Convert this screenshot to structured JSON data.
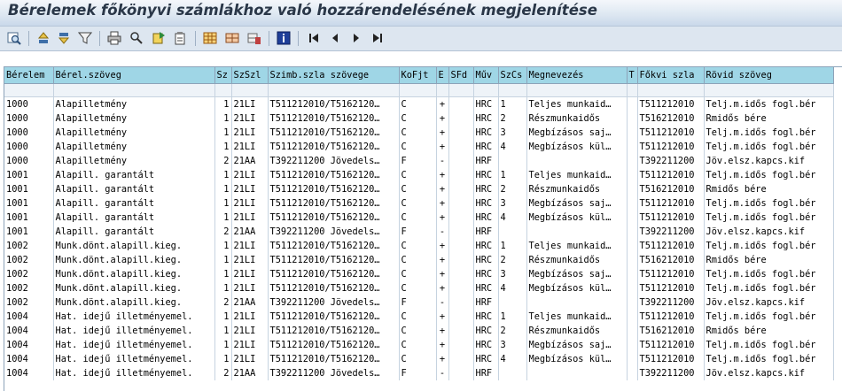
{
  "window": {
    "title": "Bérelemek főkönyvi számlákhoz való hozzárendelésének megjelenítése"
  },
  "toolbar": [
    {
      "name": "detail-icon",
      "interactable": true
    },
    {
      "name": "sort-ascending-icon",
      "interactable": true
    },
    {
      "name": "sort-descending-icon",
      "interactable": true
    },
    {
      "name": "filter-icon",
      "interactable": true
    },
    {
      "name": "print-icon",
      "interactable": true
    },
    {
      "name": "find-icon",
      "interactable": true
    },
    {
      "name": "find-next-icon",
      "interactable": true
    },
    {
      "name": "export-icon",
      "interactable": true
    },
    {
      "name": "layout-grid-icon",
      "interactable": true
    },
    {
      "name": "change-layout-icon",
      "interactable": true
    },
    {
      "name": "save-layout-icon",
      "interactable": true
    },
    {
      "name": "info-icon",
      "interactable": true
    },
    {
      "name": "first-page-icon",
      "interactable": true
    },
    {
      "name": "previous-page-icon",
      "interactable": true
    },
    {
      "name": "next-page-icon",
      "interactable": true
    },
    {
      "name": "last-page-icon",
      "interactable": true
    }
  ],
  "table": {
    "columns": [
      "Bérelem",
      "Bérel.szöveg",
      "Sz",
      "SzSzl",
      "Szimb.szla szövege",
      "KoFjt",
      "E",
      "SFd",
      "Műv",
      "SzCs",
      "Megnevezés",
      "T",
      "Főkvi szla",
      "Rövid szöveg"
    ],
    "rows": [
      [
        "1000",
        "Alapilletmény",
        "1",
        "21LI",
        "T511212010/T5162120…",
        "C",
        "+",
        "",
        "HRC",
        "1",
        "Teljes munkaid…",
        "",
        "T511212010",
        "Telj.m.idős fogl.bér"
      ],
      [
        "1000",
        "Alapilletmény",
        "1",
        "21LI",
        "T511212010/T5162120…",
        "C",
        "+",
        "",
        "HRC",
        "2",
        "Részmunkaidős",
        "",
        "T516212010",
        "Rmidős bére"
      ],
      [
        "1000",
        "Alapilletmény",
        "1",
        "21LI",
        "T511212010/T5162120…",
        "C",
        "+",
        "",
        "HRC",
        "3",
        "Megbízásos saj…",
        "",
        "T511212010",
        "Telj.m.idős fogl.bér"
      ],
      [
        "1000",
        "Alapilletmény",
        "1",
        "21LI",
        "T511212010/T5162120…",
        "C",
        "+",
        "",
        "HRC",
        "4",
        "Megbízásos kül…",
        "",
        "T511212010",
        "Telj.m.idős fogl.bér"
      ],
      [
        "1000",
        "Alapilletmény",
        "2",
        "21AA",
        "T392211200 Jövedels…",
        "F",
        "-",
        "",
        "HRF",
        "",
        "",
        "",
        "T392211200",
        "Jöv.elsz.kapcs.kif"
      ],
      [
        "1001",
        "Alapill. garantált",
        "1",
        "21LI",
        "T511212010/T5162120…",
        "C",
        "+",
        "",
        "HRC",
        "1",
        "Teljes munkaid…",
        "",
        "T511212010",
        "Telj.m.idős fogl.bér"
      ],
      [
        "1001",
        "Alapill. garantált",
        "1",
        "21LI",
        "T511212010/T5162120…",
        "C",
        "+",
        "",
        "HRC",
        "2",
        "Részmunkaidős",
        "",
        "T516212010",
        "Rmidős bére"
      ],
      [
        "1001",
        "Alapill. garantált",
        "1",
        "21LI",
        "T511212010/T5162120…",
        "C",
        "+",
        "",
        "HRC",
        "3",
        "Megbízásos saj…",
        "",
        "T511212010",
        "Telj.m.idős fogl.bér"
      ],
      [
        "1001",
        "Alapill. garantált",
        "1",
        "21LI",
        "T511212010/T5162120…",
        "C",
        "+",
        "",
        "HRC",
        "4",
        "Megbízásos kül…",
        "",
        "T511212010",
        "Telj.m.idős fogl.bér"
      ],
      [
        "1001",
        "Alapill. garantált",
        "2",
        "21AA",
        "T392211200 Jövedels…",
        "F",
        "-",
        "",
        "HRF",
        "",
        "",
        "",
        "T392211200",
        "Jöv.elsz.kapcs.kif"
      ],
      [
        "1002",
        "Munk.dönt.alapill.kieg.",
        "1",
        "21LI",
        "T511212010/T5162120…",
        "C",
        "+",
        "",
        "HRC",
        "1",
        "Teljes munkaid…",
        "",
        "T511212010",
        "Telj.m.idős fogl.bér"
      ],
      [
        "1002",
        "Munk.dönt.alapill.kieg.",
        "1",
        "21LI",
        "T511212010/T5162120…",
        "C",
        "+",
        "",
        "HRC",
        "2",
        "Részmunkaidős",
        "",
        "T516212010",
        "Rmidős bére"
      ],
      [
        "1002",
        "Munk.dönt.alapill.kieg.",
        "1",
        "21LI",
        "T511212010/T5162120…",
        "C",
        "+",
        "",
        "HRC",
        "3",
        "Megbízásos saj…",
        "",
        "T511212010",
        "Telj.m.idős fogl.bér"
      ],
      [
        "1002",
        "Munk.dönt.alapill.kieg.",
        "1",
        "21LI",
        "T511212010/T5162120…",
        "C",
        "+",
        "",
        "HRC",
        "4",
        "Megbízásos kül…",
        "",
        "T511212010",
        "Telj.m.idős fogl.bér"
      ],
      [
        "1002",
        "Munk.dönt.alapill.kieg.",
        "2",
        "21AA",
        "T392211200 Jövedels…",
        "F",
        "-",
        "",
        "HRF",
        "",
        "",
        "",
        "T392211200",
        "Jöv.elsz.kapcs.kif"
      ],
      [
        "1004",
        "Hat. idejű illetményemel.",
        "1",
        "21LI",
        "T511212010/T5162120…",
        "C",
        "+",
        "",
        "HRC",
        "1",
        "Teljes munkaid…",
        "",
        "T511212010",
        "Telj.m.idős fogl.bér"
      ],
      [
        "1004",
        "Hat. idejű illetményemel.",
        "1",
        "21LI",
        "T511212010/T5162120…",
        "C",
        "+",
        "",
        "HRC",
        "2",
        "Részmunkaidős",
        "",
        "T516212010",
        "Rmidős bére"
      ],
      [
        "1004",
        "Hat. idejű illetményemel.",
        "1",
        "21LI",
        "T511212010/T5162120…",
        "C",
        "+",
        "",
        "HRC",
        "3",
        "Megbízásos saj…",
        "",
        "T511212010",
        "Telj.m.idős fogl.bér"
      ],
      [
        "1004",
        "Hat. idejű illetményemel.",
        "1",
        "21LI",
        "T511212010/T5162120…",
        "C",
        "+",
        "",
        "HRC",
        "4",
        "Megbízásos kül…",
        "",
        "T511212010",
        "Telj.m.idős fogl.bér"
      ],
      [
        "1004",
        "Hat. idejű illetményemel.",
        "2",
        "21AA",
        "T392211200 Jövedels…",
        "F",
        "-",
        "",
        "HRF",
        "",
        "",
        "",
        "T392211200",
        "Jöv.elsz.kapcs.kif"
      ]
    ]
  }
}
